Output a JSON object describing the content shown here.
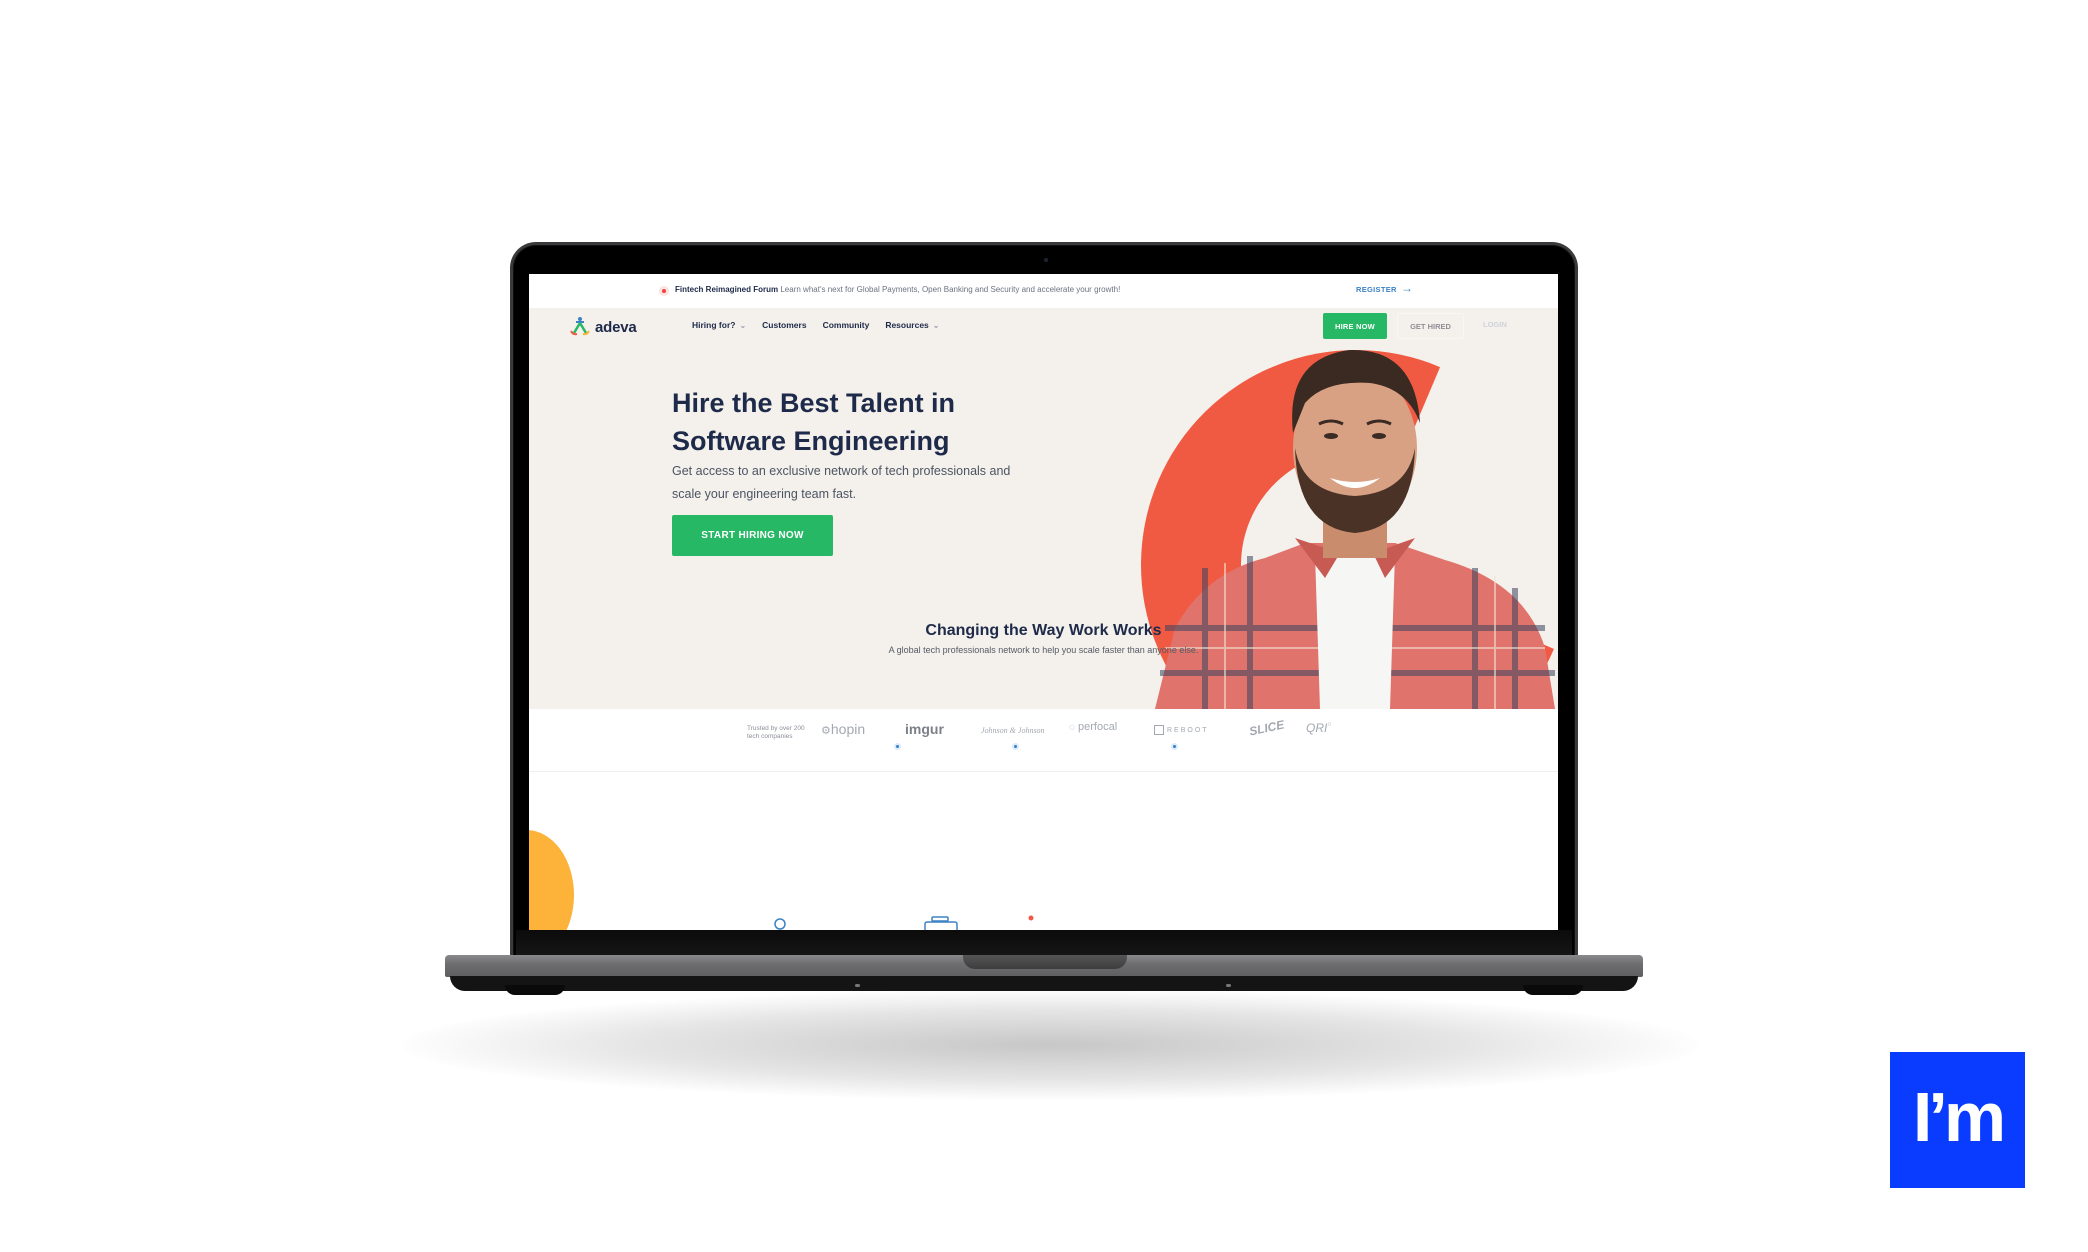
{
  "announcement": {
    "title": "Fintech Reimagined Forum",
    "message": "Learn what's next for Global Payments, Open Banking and Security and accelerate your growth!",
    "link_label": "REGISTER",
    "link_icon": "arrow-right-icon"
  },
  "nav": {
    "logo_text": "adeva",
    "links": [
      {
        "label": "Hiring for?",
        "has_dropdown": true
      },
      {
        "label": "Customers",
        "has_dropdown": false
      },
      {
        "label": "Community",
        "has_dropdown": false
      },
      {
        "label": "Resources",
        "has_dropdown": true
      }
    ],
    "hire_now_label": "HIRE NOW",
    "get_hired_label": "GET HIRED",
    "login_label": "LOGIN"
  },
  "hero": {
    "title": "Hire the Best Talent in Software Engineering",
    "subtitle": "Get access to an exclusive network of tech professionals and scale your engineering team fast.",
    "cta_label": "START HIRING NOW"
  },
  "trusted": {
    "label": "Trusted by over 200 tech companies",
    "brands": [
      "hopin",
      "imgur",
      "Johnson & Johnson",
      "perfocal",
      "REBOOT",
      "SLICE",
      "QRI"
    ]
  },
  "section": {
    "title": "Changing the Way Work Works",
    "subtitle": "A global tech professionals network to help you scale faster than anyone else."
  },
  "badge": {
    "text": "I’m"
  },
  "colors": {
    "brand_green": "#27b866",
    "accent_red": "#f15a42",
    "navy": "#1e2a4a",
    "hero_bg": "#f4f0eb",
    "link_blue": "#3b82c4",
    "badge_blue": "#0a3cff",
    "blob_yellow": "#fdb239"
  }
}
